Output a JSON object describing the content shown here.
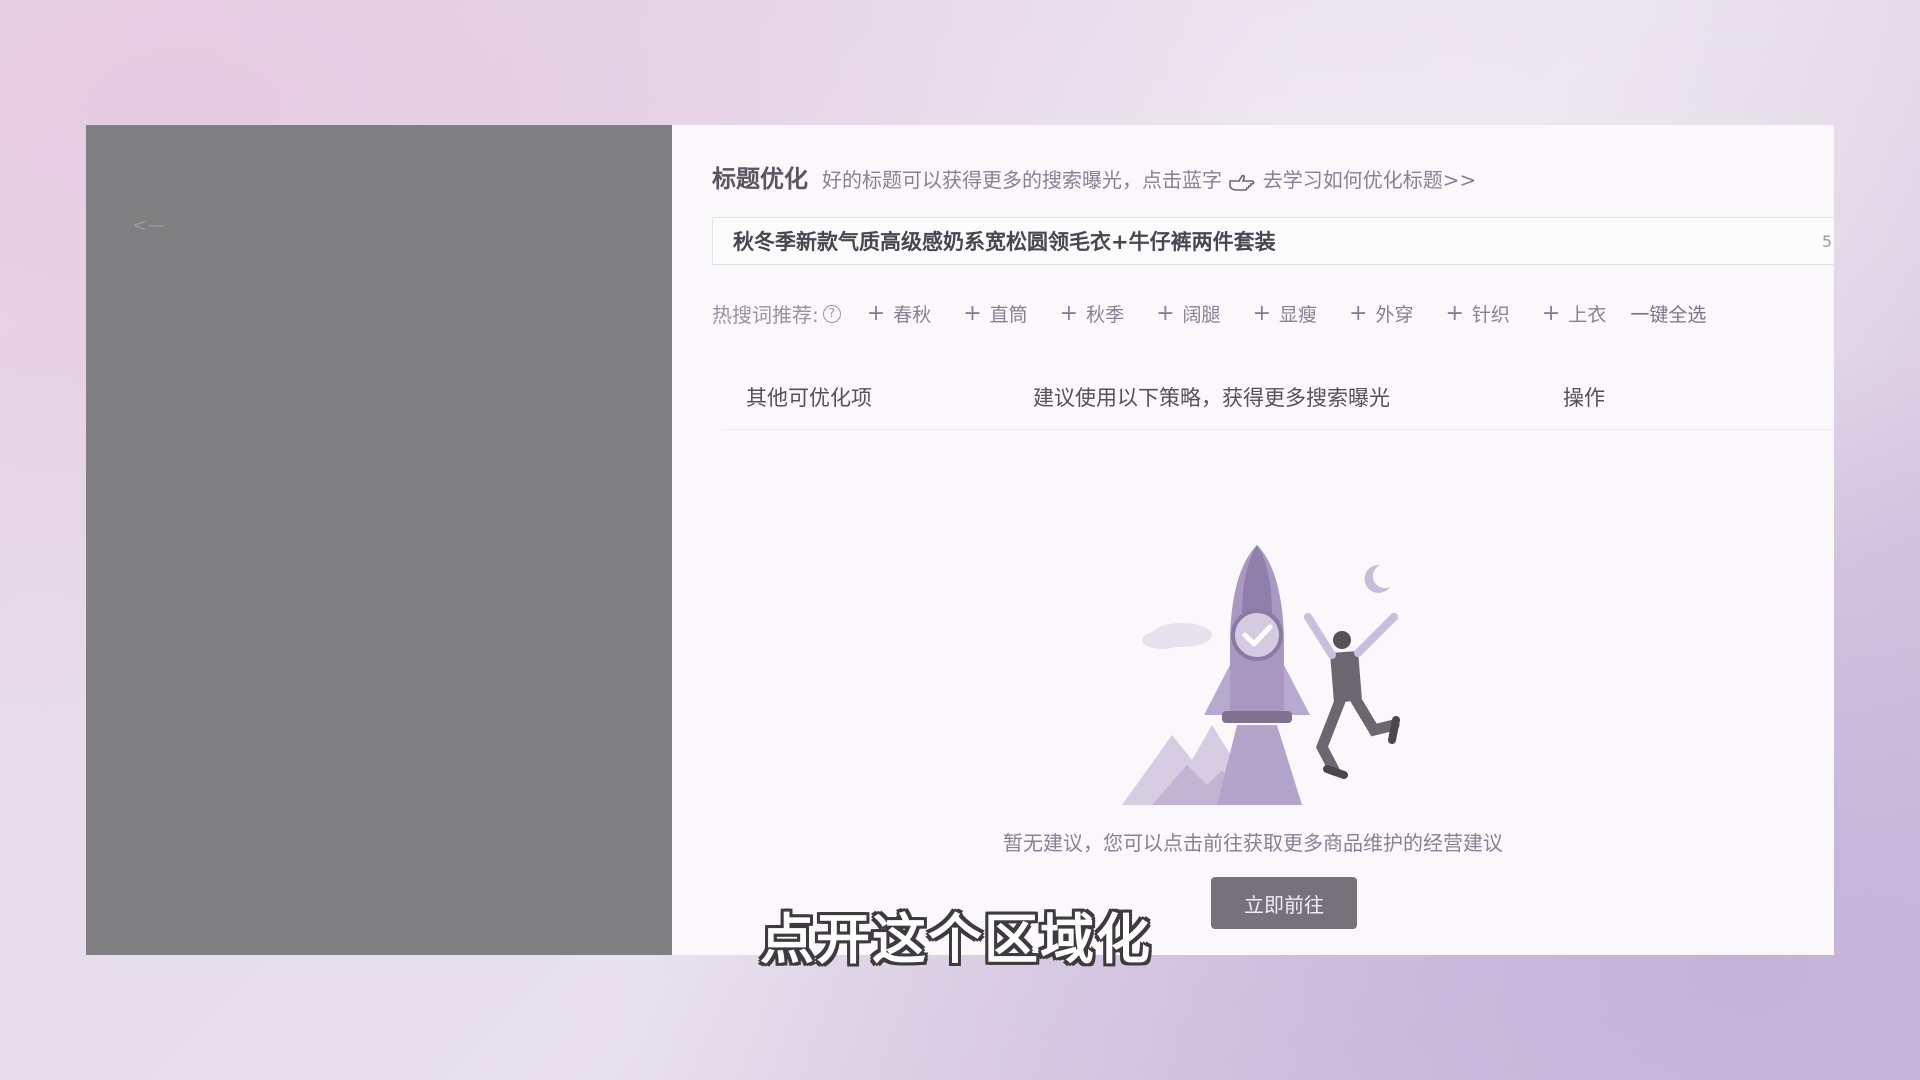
{
  "header": {
    "title": "标题优化",
    "hint_before_icon": "好的标题可以获得更多的搜索曝光，点击蓝字",
    "hint_link": "去学习如何优化标题>>"
  },
  "title_input": {
    "value": "秋冬季新款气质高级感奶系宽松圆领毛衣+牛仔裤两件套装",
    "counter": "5"
  },
  "hot_words": {
    "label": "热搜词推荐:",
    "help_icon": "?",
    "tags": [
      "春秋",
      "直筒",
      "秋季",
      "阔腿",
      "显瘦",
      "外穿",
      "针织",
      "上衣"
    ],
    "plus": "+",
    "select_all": "一键全选"
  },
  "table": {
    "columns": [
      "其他可优化项",
      "建议使用以下策略，获得更多搜索曝光",
      "操作"
    ]
  },
  "empty_state": {
    "message": "暂无建议，您可以点击前往获取更多商品维护的经营建议",
    "button": "立即前往"
  },
  "left_panel": {
    "back_mark": "<—"
  },
  "subtitle": "点开这个区域化",
  "colors": {
    "left_panel_bg": "#808082",
    "panel_bg": "#faf8fa",
    "accent_purple": "#8a7f96",
    "button_bg": "#76727a"
  }
}
